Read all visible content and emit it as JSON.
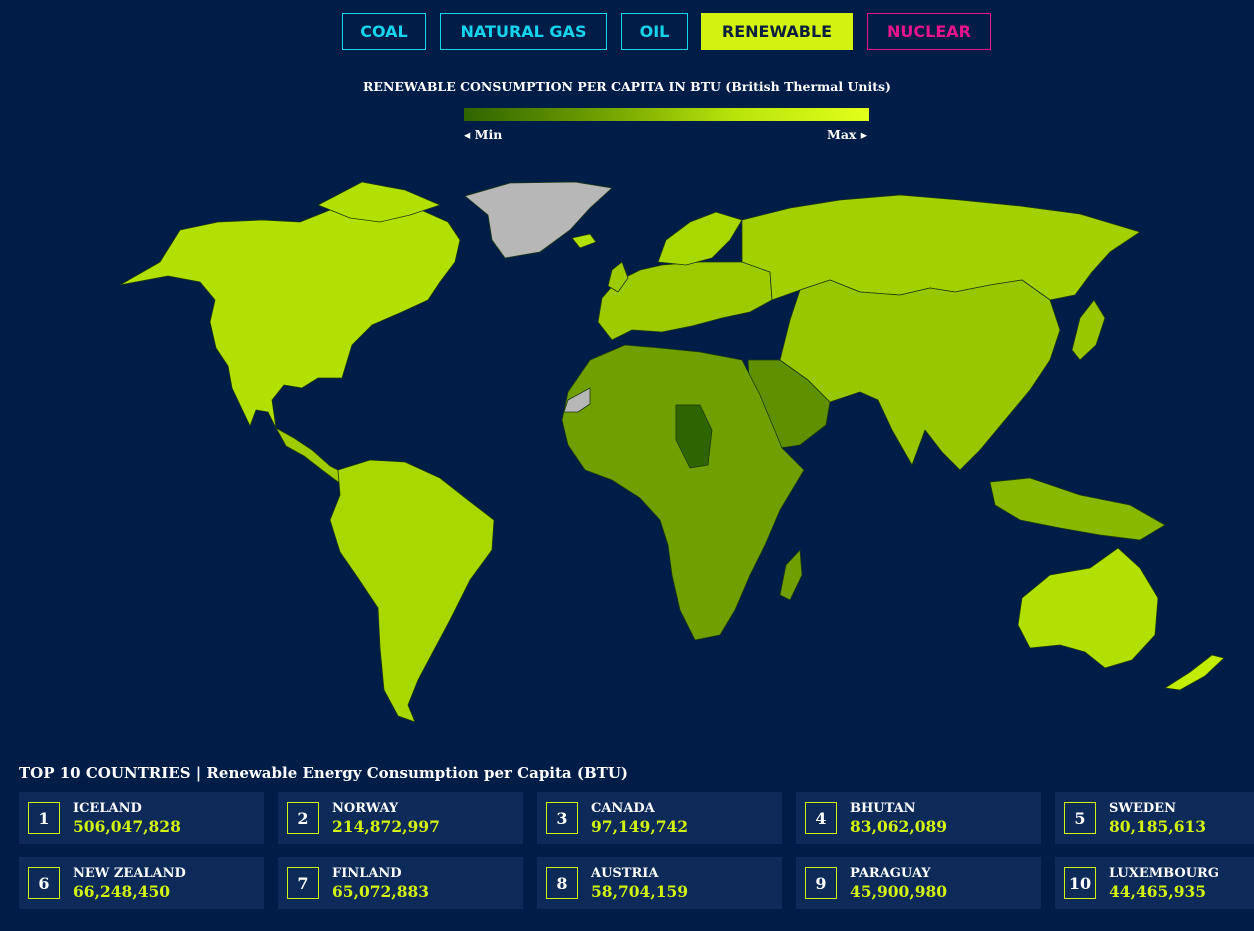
{
  "tabs": [
    {
      "label": "COAL"
    },
    {
      "label": "NATURAL GAS"
    },
    {
      "label": "OIL"
    },
    {
      "label": "RENEWABLE"
    },
    {
      "label": "NUCLEAR"
    }
  ],
  "active_tab": "RENEWABLE",
  "legend": {
    "title": "RENEWABLE CONSUMPTION PER CAPITA IN BTU (British Thermal Units)",
    "min_label": "◂ Min",
    "max_label": "Max ▸",
    "colors": [
      "#2f6500",
      "#6f9f00",
      "#b8e40a",
      "#e2ff1a"
    ]
  },
  "map": {
    "type": "choropleth world map",
    "no_data_color": "#b7b7b7",
    "regions": [
      {
        "name": "north-america",
        "level": "high"
      },
      {
        "name": "greenland",
        "level": "no-data"
      },
      {
        "name": "south-america",
        "level": "medium-high"
      },
      {
        "name": "europe",
        "level": "medium-high"
      },
      {
        "name": "africa",
        "level": "medium-low"
      },
      {
        "name": "middle-east",
        "level": "low"
      },
      {
        "name": "russia",
        "level": "medium-high"
      },
      {
        "name": "asia",
        "level": "medium"
      },
      {
        "name": "australia",
        "level": "high"
      },
      {
        "name": "new-zealand",
        "level": "high"
      }
    ]
  },
  "top10": {
    "title": "TOP 10 COUNTRIES | Renewable Energy Consumption per Capita (BTU)",
    "items": [
      {
        "rank": "1",
        "country": "ICELAND",
        "value": "506,047,828"
      },
      {
        "rank": "2",
        "country": "NORWAY",
        "value": "214,872,997"
      },
      {
        "rank": "3",
        "country": "CANADA",
        "value": "97,149,742"
      },
      {
        "rank": "4",
        "country": "BHUTAN",
        "value": "83,062,089"
      },
      {
        "rank": "5",
        "country": "SWEDEN",
        "value": "80,185,613"
      },
      {
        "rank": "6",
        "country": "NEW ZEALAND",
        "value": "66,248,450"
      },
      {
        "rank": "7",
        "country": "FINLAND",
        "value": "65,072,883"
      },
      {
        "rank": "8",
        "country": "AUSTRIA",
        "value": "58,704,159"
      },
      {
        "rank": "9",
        "country": "PARAGUAY",
        "value": "45,900,980"
      },
      {
        "rank": "10",
        "country": "LUXEMBOURG",
        "value": "44,465,935"
      }
    ]
  }
}
